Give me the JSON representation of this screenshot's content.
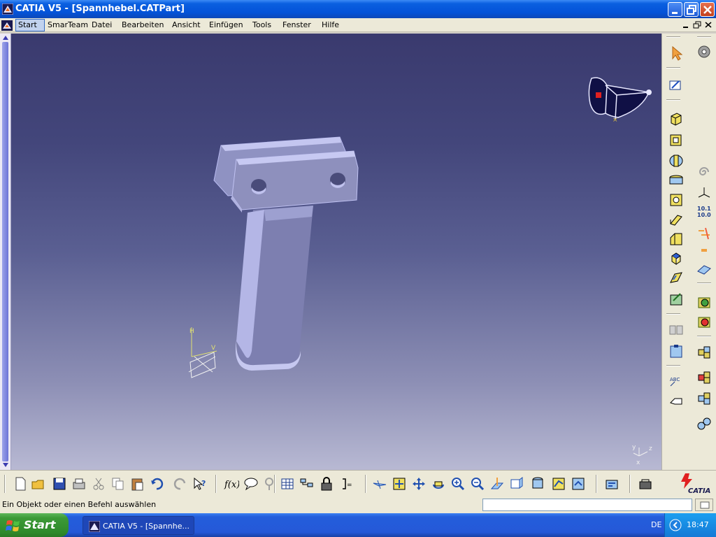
{
  "window": {
    "title": "CATIA V5 - [Spannhebel.CATPart]"
  },
  "menu": {
    "items": [
      {
        "label": "Start",
        "active": true
      },
      {
        "label": "SmarTeam"
      },
      {
        "label": "Datei"
      },
      {
        "label": "Bearbeiten"
      },
      {
        "label": "Ansicht"
      },
      {
        "label": "Einfügen"
      },
      {
        "label": "Tools"
      },
      {
        "label": "Fenster"
      },
      {
        "label": "Hilfe"
      }
    ]
  },
  "viewport": {
    "background_top": "#3a3a6e",
    "background_bottom": "#b8b9d3",
    "axis_labels": {
      "h": "H",
      "v": "V",
      "x": "x",
      "y": "y",
      "z": "z"
    }
  },
  "right_toolbar": {
    "icons": [
      "select-arrow-icon",
      "sketch-icon",
      "pad-icon",
      "pocket-icon",
      "shaft-icon",
      "rib-icon",
      "hole-icon",
      "fillet-icon",
      "chamfer-icon",
      "draft-icon",
      "shell-icon",
      "thickness-icon",
      "mirror-icon",
      "pattern-icon",
      "text-annotation-icon",
      "flag-note-icon",
      "gear-icon",
      "spiral-icon",
      "axis-system-icon",
      "measure-icon",
      "constraint-icon",
      "surface-icon",
      "apply-material-icon",
      "render-icon",
      "assembly-icon",
      "catalog-icon",
      "boolean-icon"
    ],
    "measure_text": "10.1\n10.0"
  },
  "bottom_toolbar": {
    "icons": [
      "new-icon",
      "open-icon",
      "save-icon",
      "print-icon",
      "cut-icon",
      "copy-icon",
      "paste-icon",
      "undo-icon",
      "redo-icon",
      "whats-this-icon",
      "formula-icon",
      "comment-icon",
      "search-icon",
      "table-icon",
      "tree-icon",
      "lock-icon",
      "parameters-icon",
      "fly-mode-icon",
      "fit-all-icon",
      "pan-icon",
      "rotate-icon",
      "zoom-in-icon",
      "zoom-out-icon",
      "normal-view-icon",
      "view-icon",
      "render-style-icon",
      "hide-show-icon",
      "swap-visible-icon",
      "update-icon",
      "catia-settings-icon"
    ],
    "brand": "CATIA"
  },
  "status": {
    "message": "Ein Objekt oder einen Befehl auswählen",
    "command_value": ""
  },
  "taskbar": {
    "start_label": "Start",
    "task_label": "CATIA V5 - [Spannhe...",
    "language": "DE",
    "time": "18:47"
  }
}
